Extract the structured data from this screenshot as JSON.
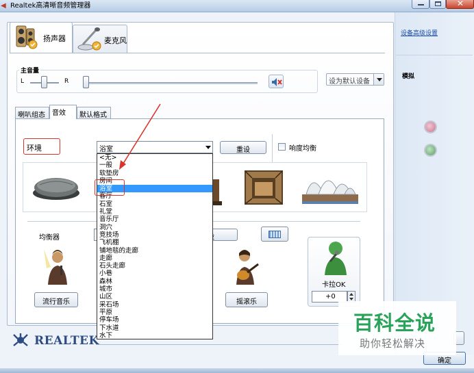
{
  "window": {
    "title": "Realtek高清晰音频管理器"
  },
  "devices": {
    "speaker_label": "扬声器",
    "mic_label": "麦克风"
  },
  "master_volume": {
    "title": "主音量",
    "left_label": "L",
    "right_label": "R",
    "balance_value": 0.5,
    "volume_value": 0.0,
    "default_device_label": "设为默认设备"
  },
  "tabs": [
    {
      "label": "喇叭组态"
    },
    {
      "label": "音效"
    },
    {
      "label": "默认格式"
    }
  ],
  "environment": {
    "label": "环境",
    "selected": "浴室",
    "reset_label": "重设",
    "loudness_label": "响度均衡",
    "options": [
      "<无>",
      "一般",
      "软垫房",
      "房间",
      "浴室",
      "客厅",
      "石室",
      "礼堂",
      "音乐厅",
      "洞穴",
      "竞技场",
      "飞机棚",
      "铺地毯的走廊",
      "走廊",
      "石头走廊",
      "小巷",
      "森林",
      "城市",
      "山区",
      "采石场",
      "平原",
      "停车场",
      "下水道",
      "水下"
    ],
    "selected_index": 4
  },
  "equalizer": {
    "label": "均衡器",
    "reset_partial": "设",
    "pop_label": "流行音乐",
    "rock_label": "摇滚乐"
  },
  "karaoke": {
    "label": "卡拉OK",
    "value": "+0"
  },
  "sidebar": {
    "advanced_link": "设备高级设置",
    "analog_label": "模拟"
  },
  "footer": {
    "brand": "REALTEK",
    "ok_label": "确定"
  },
  "watermark": {
    "title": "百科全说",
    "subtitle": "助你轻松解决"
  },
  "colors": {
    "highlight": "#3399ff",
    "annotation_red": "#d9342b",
    "watermark_green": "#2aa35a"
  }
}
